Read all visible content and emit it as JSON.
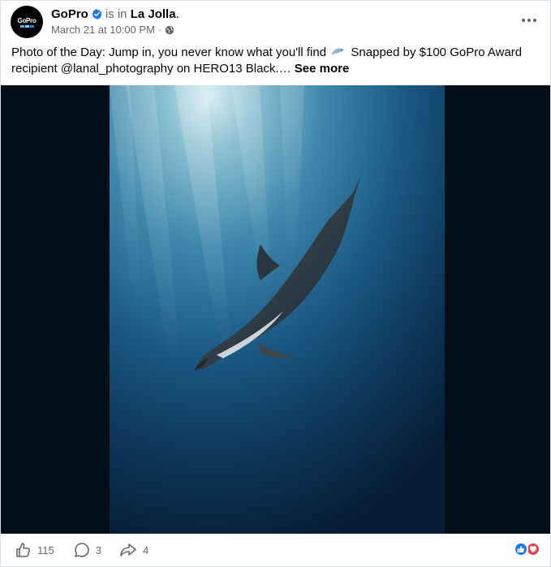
{
  "post": {
    "page_name": "GoPro",
    "is_in_text": "is in",
    "place": "La Jolla",
    "place_suffix": ".",
    "timestamp": "March 21 at 10:00 PM",
    "separator": "·",
    "privacy_icon": "globe-icon",
    "avatar_logo_text": "GoPro",
    "caption_part1": "Photo of the Day: Jump in, you never know what you'll find",
    "caption_emoji": "dolphin-emoji",
    "caption_part2": "Snapped by $100 GoPro Award recipient @lanal_photography on HERO13 Black.…",
    "see_more": "See more",
    "photo_subject": "dolphin-underwater-photo"
  },
  "footer": {
    "like_count": "115",
    "comment_count": "3",
    "share_count": "4",
    "reactions": [
      "like",
      "love"
    ]
  },
  "colors": {
    "verified_blue": "#1877f2",
    "secondary_text": "#65676b",
    "like_blue": "#1877f2",
    "love_red": "#f33e58",
    "media_bg": "#020e18"
  }
}
